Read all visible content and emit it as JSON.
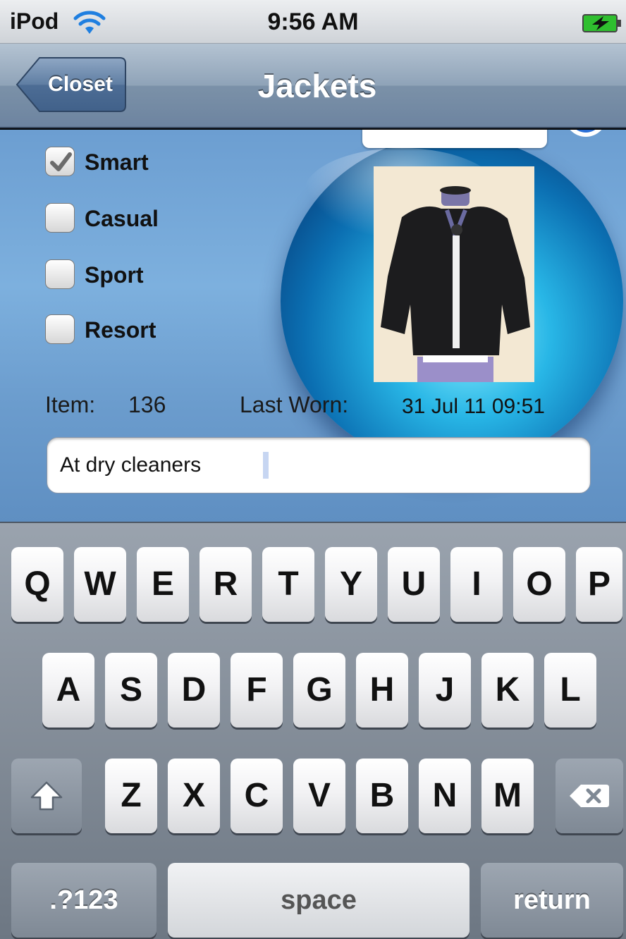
{
  "status_bar": {
    "carrier": "iPod",
    "time": "9:56 AM"
  },
  "nav": {
    "back_label": "Closet",
    "title": "Jackets"
  },
  "categories": [
    {
      "label": "Smart",
      "checked": true
    },
    {
      "label": "Casual",
      "checked": false
    },
    {
      "label": "Sport",
      "checked": false
    },
    {
      "label": "Resort",
      "checked": false
    }
  ],
  "item": {
    "item_label": "Item:",
    "item_number": "136",
    "last_worn_label": "Last Worn:",
    "last_worn_value": "31 Jul 11 09:51"
  },
  "note_field": {
    "value": "At dry cleaners"
  },
  "keyboard": {
    "row1": [
      "Q",
      "W",
      "E",
      "R",
      "T",
      "Y",
      "U",
      "I",
      "O",
      "P"
    ],
    "row2": [
      "A",
      "S",
      "D",
      "F",
      "G",
      "H",
      "J",
      "K",
      "L"
    ],
    "row3": [
      "Z",
      "X",
      "C",
      "V",
      "B",
      "N",
      "M"
    ],
    "numbers_key": ".?123",
    "space_key": "space",
    "return_key": "return"
  },
  "colors": {
    "nav_bar": "#7b91a8",
    "content_bg": "#7db0de",
    "battery_charge": "#3fd23f"
  }
}
